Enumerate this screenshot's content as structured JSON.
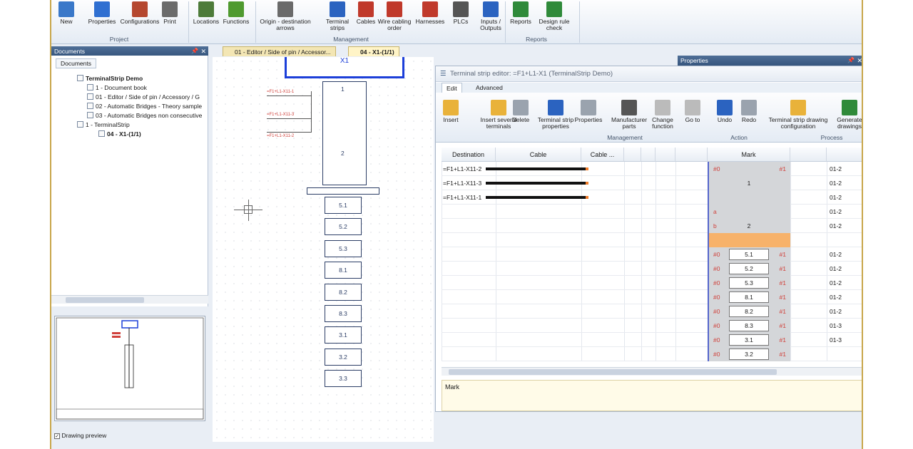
{
  "ribbon": {
    "buttons": [
      {
        "label": "New",
        "icon": "new-icon"
      },
      {
        "label": "Properties",
        "icon": "info-icon"
      },
      {
        "label": "Configurations",
        "icon": "configurations-icon"
      },
      {
        "label": "Print",
        "icon": "print-icon"
      },
      {
        "label": "Locations",
        "icon": "locations-icon"
      },
      {
        "label": "Functions",
        "icon": "functions-icon"
      },
      {
        "label": "Origin - destination arrows",
        "icon": "arrows-icon"
      },
      {
        "label": "Terminal strips",
        "icon": "terminal-strip-icon"
      },
      {
        "label": "Cables",
        "icon": "cables-icon"
      },
      {
        "label": "Wire cabling order",
        "icon": "wire-cabling-icon"
      },
      {
        "label": "Harnesses",
        "icon": "harness-icon"
      },
      {
        "label": "PLCs",
        "icon": "plc-icon"
      },
      {
        "label": "Inputs / Outputs",
        "icon": "io-icon"
      },
      {
        "label": "Reports",
        "icon": "reports-icon"
      },
      {
        "label": "Design rule check",
        "icon": "rule-check-icon"
      }
    ],
    "groups": {
      "project": "Project",
      "management": "Management",
      "reports": "Reports"
    }
  },
  "docs_panel": {
    "title": "Documents",
    "tab": "Documents",
    "tree": [
      "TerminalStrip Demo",
      "1 - Document book",
      "01 - Editor / Side of pin / Accessory / G",
      "02 - Automatic Bridges - Theory sample",
      "03 - Automatic Bridges non consecutive",
      "1 - TerminalStrip",
      "04 - X1-(1/1)"
    ],
    "drawing_preview_label": "Drawing preview"
  },
  "doc_tabs": [
    "01 - Editor / Side of pin / Accessor...",
    "04 - X1-(1/1)"
  ],
  "canvas": {
    "title_label": "X1",
    "wire_labels": [
      "=F1+L1-X11-1",
      "=F1+L1-X11-3",
      "=F1+L1-X11-2"
    ],
    "cells": [
      "1",
      "2",
      "5.1",
      "5.2",
      "5.3",
      "8.1",
      "8.2",
      "8.3",
      "3.1",
      "3.2",
      "3.3"
    ]
  },
  "properties_panel": {
    "title": "Properties"
  },
  "editor": {
    "title": "Terminal strip editor: =F1+L1-X1 (TerminalStrip Demo)",
    "tabs": [
      "Edit",
      "Advanced"
    ],
    "buttons": [
      {
        "label": "Insert",
        "icon": "insert-icon"
      },
      {
        "label": "Insert several terminals",
        "icon": "insert-several-icon"
      },
      {
        "label": "Delete",
        "icon": "delete-icon"
      },
      {
        "label": "Terminal strip properties",
        "icon": "strip-properties-icon"
      },
      {
        "label": "Properties",
        "icon": "info-icon"
      },
      {
        "label": "Manufacturer parts",
        "icon": "manufacturer-icon"
      },
      {
        "label": "Change function",
        "icon": "change-function-icon"
      },
      {
        "label": "Go to",
        "icon": "goto-icon"
      },
      {
        "label": "Undo",
        "icon": "undo-icon"
      },
      {
        "label": "Redo",
        "icon": "redo-icon"
      },
      {
        "label": "Terminal strip drawing configuration",
        "icon": "drawing-config-icon"
      },
      {
        "label": "Generate drawings",
        "icon": "generate-icon"
      }
    ],
    "groups": {
      "management": "Management",
      "action": "Action",
      "process": "Process"
    },
    "columns": [
      "Destination",
      "Cable",
      "Cable ...",
      "Mark"
    ],
    "rows": [
      {
        "destination": "=F1+L1-X11-2",
        "mark": "",
        "left": "#0",
        "right": "#1",
        "ref": "01-2",
        "cable": true
      },
      {
        "destination": "=F1+L1-X11-3",
        "mark": "1",
        "left": "",
        "right": "",
        "ref": "01-2",
        "cable": true
      },
      {
        "destination": "=F1+L1-X11-1",
        "mark": "",
        "left": "",
        "right": "",
        "ref": "01-2",
        "cable": true
      },
      {
        "destination": "",
        "mark": "",
        "left": "a",
        "right": "",
        "ref": "01-2",
        "cable": false
      },
      {
        "destination": "",
        "mark": "2",
        "left": "b",
        "right": "",
        "ref": "01-2",
        "cable": false
      },
      {
        "destination": "",
        "mark": "",
        "left": "",
        "right": "",
        "ref": "",
        "cable": false
      },
      {
        "destination": "",
        "mark": "5.1",
        "left": "#0",
        "right": "#1",
        "ref": "01-2",
        "cable": false
      },
      {
        "destination": "",
        "mark": "5.2",
        "left": "#0",
        "right": "#1",
        "ref": "01-2",
        "cable": false
      },
      {
        "destination": "",
        "mark": "5.3",
        "left": "#0",
        "right": "#1",
        "ref": "01-2",
        "cable": false
      },
      {
        "destination": "",
        "mark": "8.1",
        "left": "#0",
        "right": "#1",
        "ref": "01-2",
        "cable": false
      },
      {
        "destination": "",
        "mark": "8.2",
        "left": "#0",
        "right": "#1",
        "ref": "01-2",
        "cable": false
      },
      {
        "destination": "",
        "mark": "8.3",
        "left": "#0",
        "right": "#1",
        "ref": "01-3",
        "cable": false
      },
      {
        "destination": "",
        "mark": "3.1",
        "left": "#0",
        "right": "#1",
        "ref": "01-3",
        "cable": false
      },
      {
        "destination": "",
        "mark": "3.2",
        "left": "#0",
        "right": "#1",
        "ref": "",
        "cable": false
      }
    ],
    "mark_field_label": "Mark"
  },
  "colors": {
    "accent": "#36557d",
    "cable_end": "#f07c2a",
    "highlight_row": "#f7b26a"
  }
}
